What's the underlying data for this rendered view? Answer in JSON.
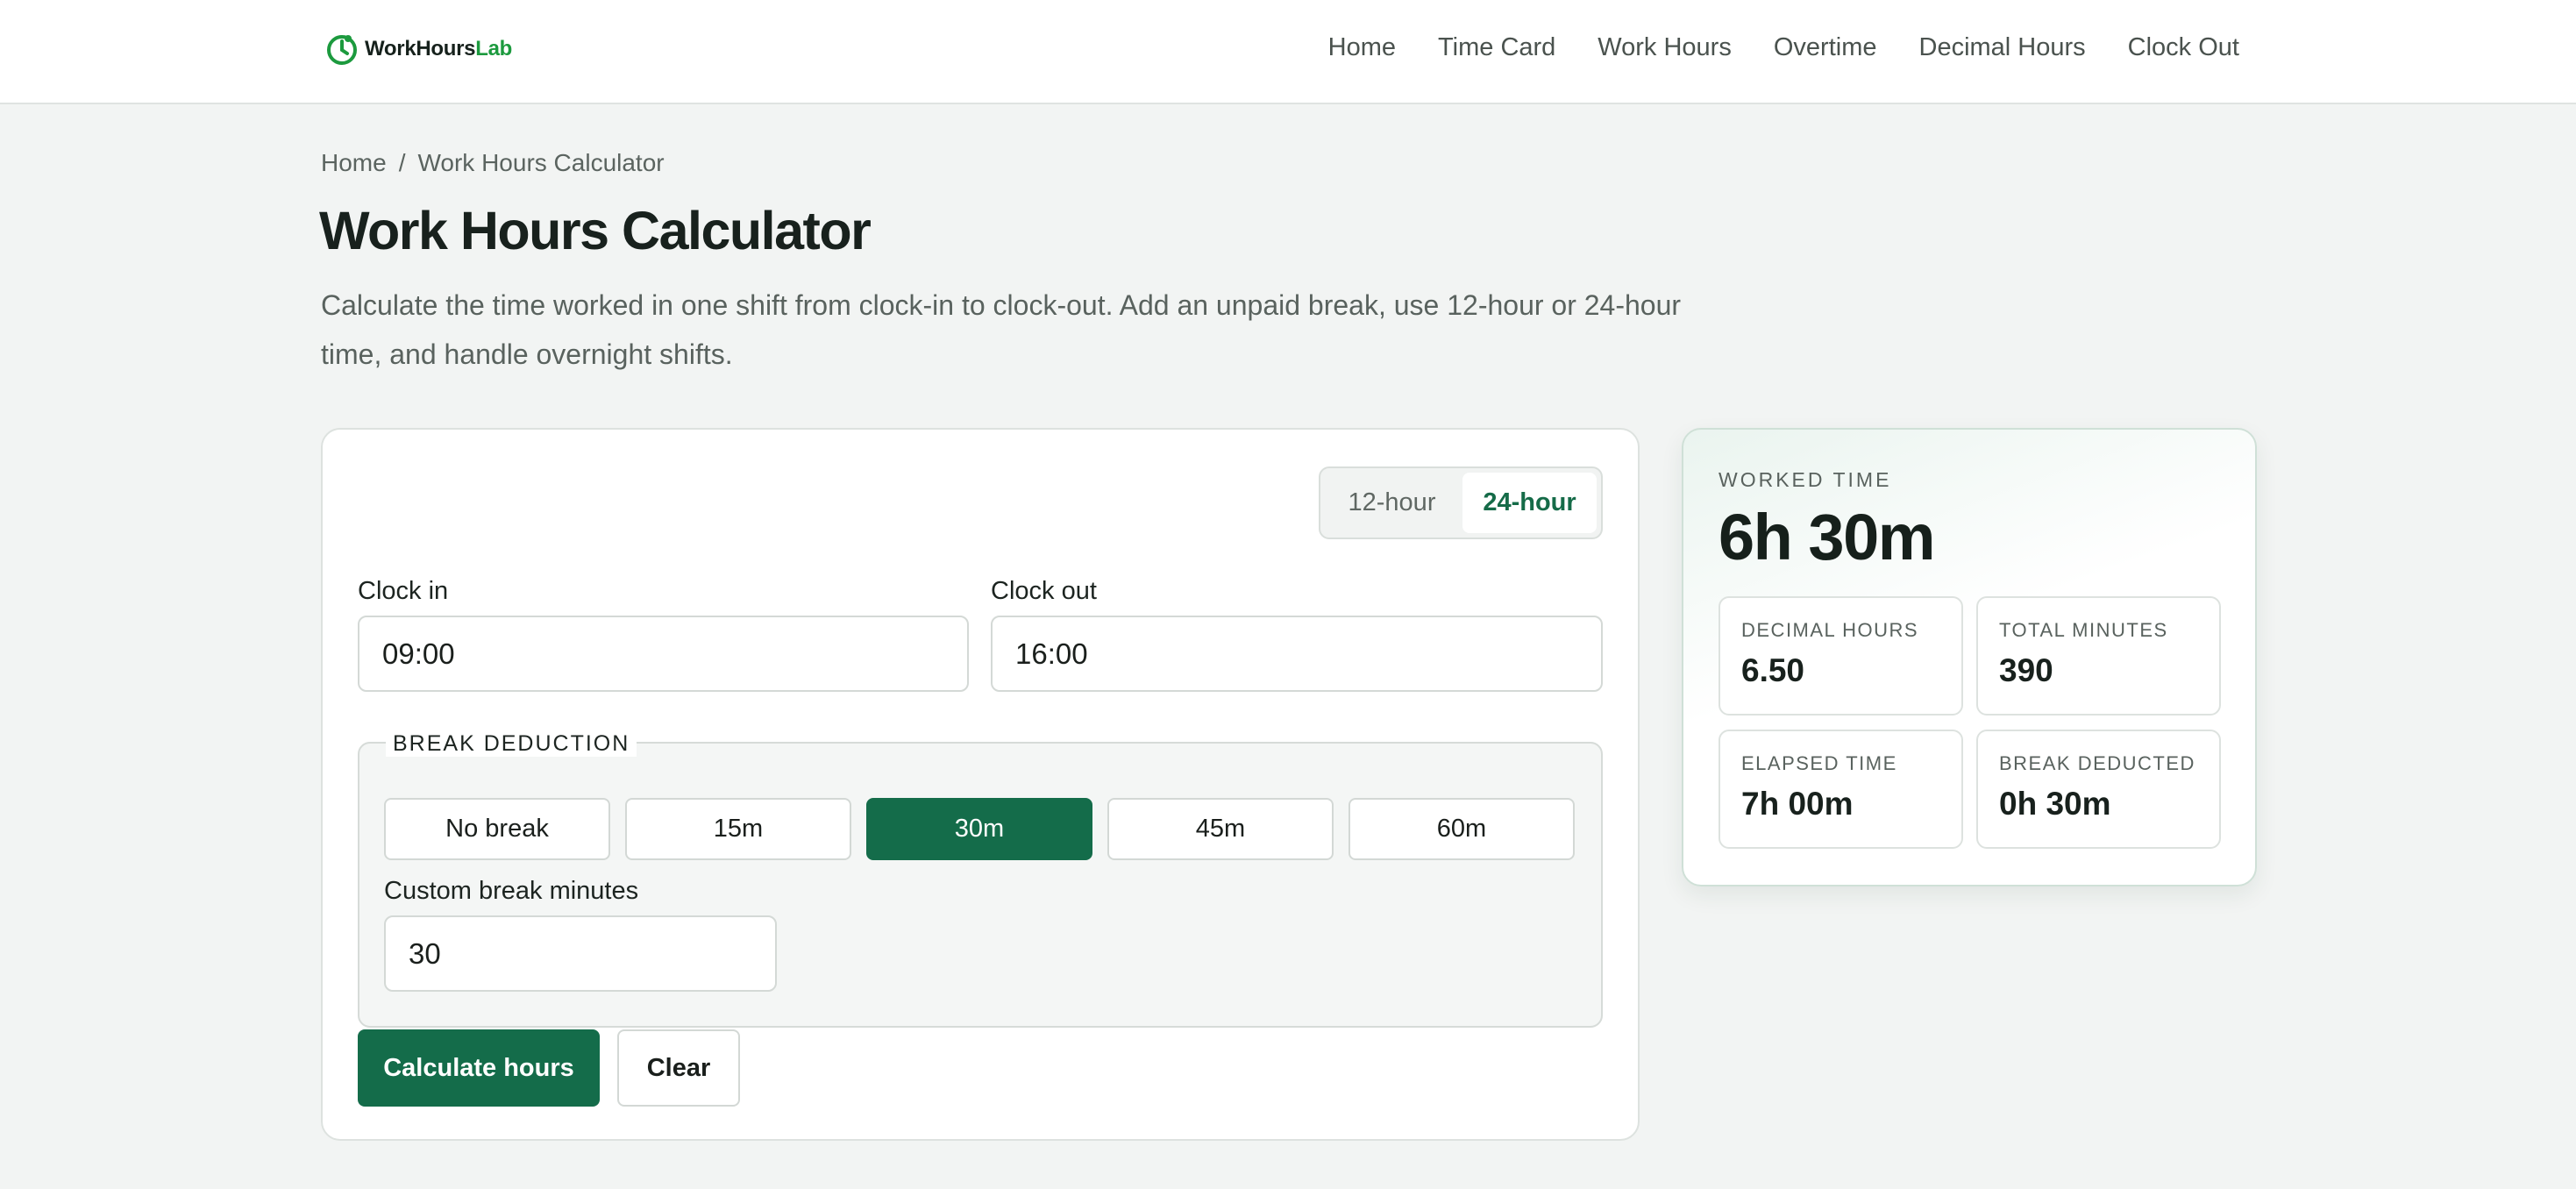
{
  "brand": {
    "name_main": "WorkHours",
    "name_accent": "Lab",
    "accent_color": "#1c9a3e",
    "icon": "clock-logo-icon"
  },
  "nav": {
    "items": [
      "Home",
      "Time Card",
      "Work Hours",
      "Overtime",
      "Decimal Hours",
      "Clock Out"
    ]
  },
  "breadcrumb": {
    "home": "Home",
    "separator": "/",
    "current": "Work Hours Calculator"
  },
  "page": {
    "title": "Work Hours Calculator",
    "description": "Calculate the time worked in one shift from clock-in to clock-out. Add an unpaid break, use 12-hour or 24-hour time, and handle overnight shifts."
  },
  "form": {
    "time_format": {
      "options": [
        "12-hour",
        "24-hour"
      ],
      "selected": "24-hour"
    },
    "clock_in": {
      "label": "Clock in",
      "value": "09:00"
    },
    "clock_out": {
      "label": "Clock out",
      "value": "16:00"
    },
    "break": {
      "legend": "BREAK DEDUCTION",
      "options": [
        "No break",
        "15m",
        "30m",
        "45m",
        "60m"
      ],
      "selected": "30m",
      "custom_label": "Custom break minutes",
      "custom_value": "30"
    },
    "calculate_label": "Calculate hours",
    "clear_label": "Clear"
  },
  "result": {
    "label": "WORKED TIME",
    "value": "6h 30m",
    "stats": [
      {
        "label": "DECIMAL HOURS",
        "value": "6.50"
      },
      {
        "label": "TOTAL MINUTES",
        "value": "390"
      },
      {
        "label": "ELAPSED TIME",
        "value": "7h 00m"
      },
      {
        "label": "BREAK DEDUCTED",
        "value": "0h 30m"
      }
    ]
  },
  "colors": {
    "primary": "#146c4a",
    "background": "#f2f4f3"
  }
}
